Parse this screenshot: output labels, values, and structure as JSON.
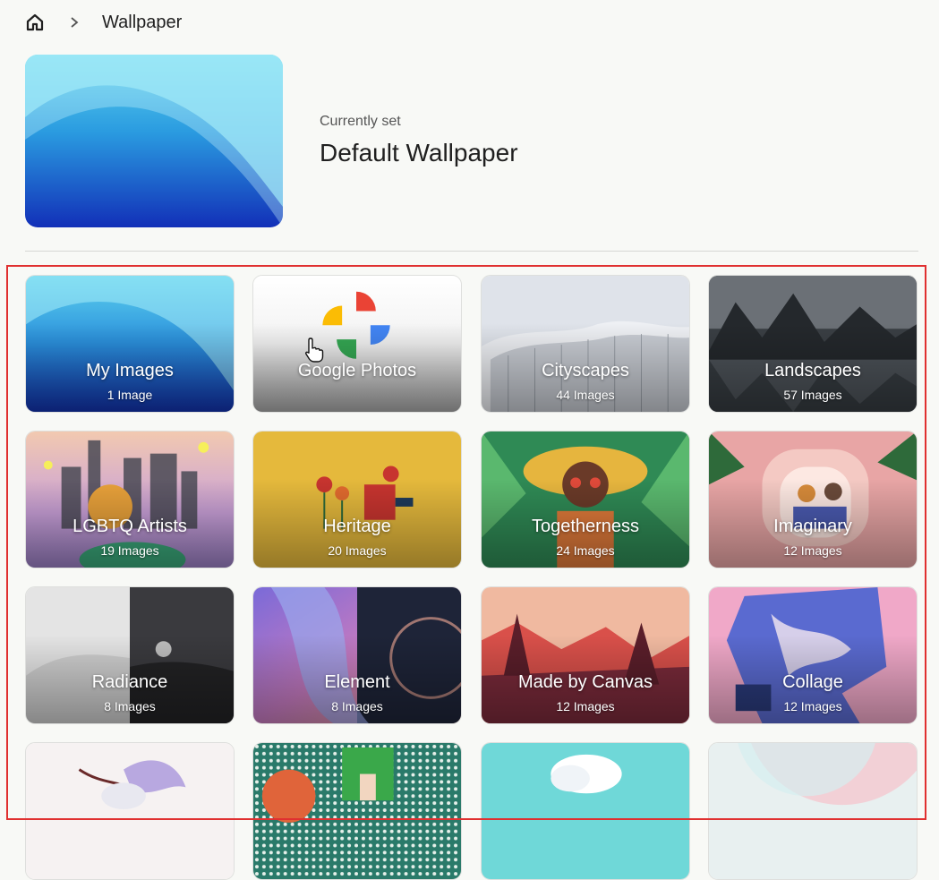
{
  "breadcrumb": {
    "home_icon": "home-icon",
    "separator_icon": "chevron-right-icon",
    "title": "Wallpaper"
  },
  "current": {
    "label": "Currently set",
    "name": "Default Wallpaper"
  },
  "collections": [
    {
      "title": "My Images",
      "count": "1 Image"
    },
    {
      "title": "Google Photos",
      "count": ""
    },
    {
      "title": "Cityscapes",
      "count": "44 Images"
    },
    {
      "title": "Landscapes",
      "count": "57 Images"
    },
    {
      "title": "LGBTQ Artists",
      "count": "19 Images"
    },
    {
      "title": "Heritage",
      "count": "20 Images"
    },
    {
      "title": "Togetherness",
      "count": "24 Images"
    },
    {
      "title": "Imaginary",
      "count": "12 Images"
    },
    {
      "title": "Radiance",
      "count": "8 Images"
    },
    {
      "title": "Element",
      "count": "8 Images"
    },
    {
      "title": "Made by Canvas",
      "count": "12 Images"
    },
    {
      "title": "Collage",
      "count": "12 Images"
    },
    {
      "title": "",
      "count": ""
    },
    {
      "title": "",
      "count": ""
    },
    {
      "title": "",
      "count": ""
    },
    {
      "title": "",
      "count": ""
    }
  ],
  "colors": {
    "selection_outline": "#e03030",
    "background": "#f8f9f6"
  }
}
